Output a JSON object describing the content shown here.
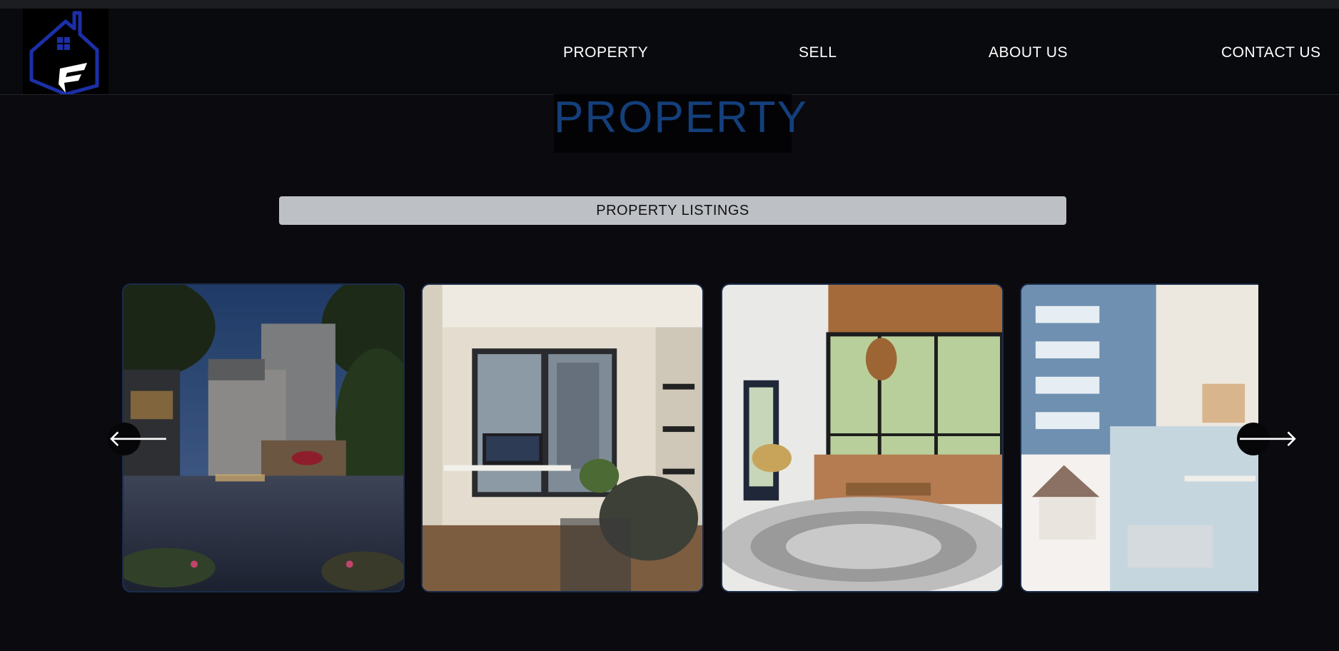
{
  "nav": {
    "logo_letter": "F",
    "links": [
      "PROPERTY",
      "SELL",
      "ABOUT US",
      "CONTACT US"
    ]
  },
  "page_title": "PROPERTY",
  "listings_label": "PROPERTY LISTINGS",
  "carousel": {
    "prev_icon": "arrow-left-icon",
    "next_icon": "arrow-right-icon",
    "prev_glyph": "🡐",
    "next_glyph": "🡒",
    "cards": [
      {
        "name": "modern-concrete-house-photo"
      },
      {
        "name": "home-office-room-photo"
      },
      {
        "name": "living-room-photo"
      },
      {
        "name": "real-estate-collage-photo"
      }
    ]
  },
  "colors": {
    "background": "#0a0a0f",
    "title": "#143f7c",
    "listings_bar": "#bdc0c5",
    "logo_blue": "#1c2fa8"
  }
}
